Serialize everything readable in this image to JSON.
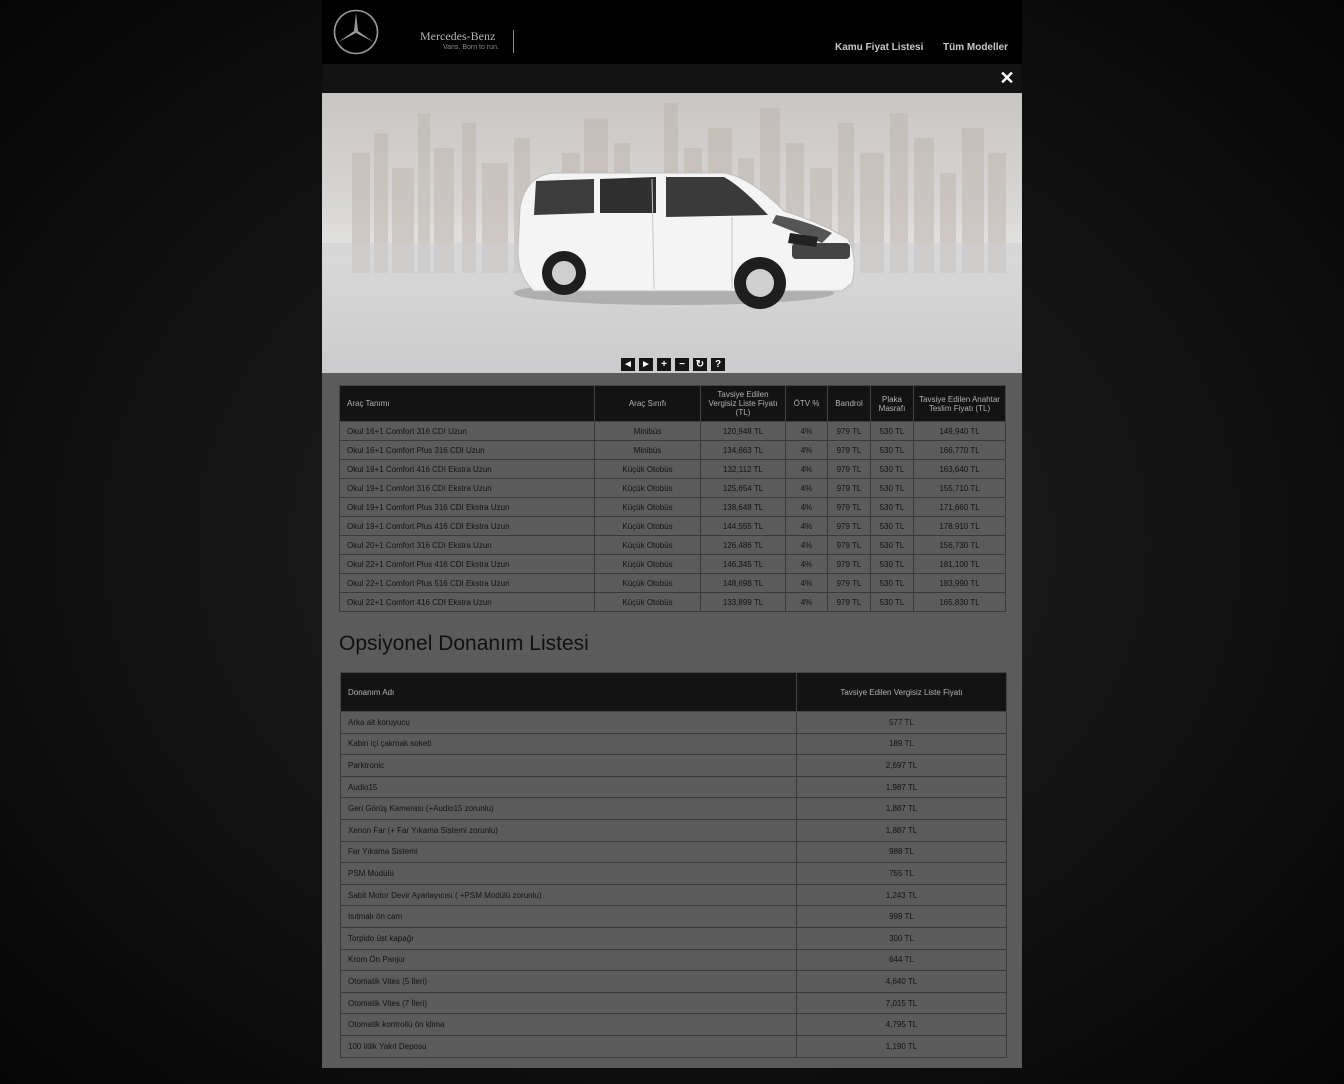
{
  "header": {
    "brand": "Mercedes-Benz",
    "tagline": "Vans. Born to run.",
    "nav": [
      {
        "label": "Kamu Fiyat Listesi"
      },
      {
        "label": "Tüm Modeller"
      }
    ]
  },
  "modal": {
    "close_glyph": "✕",
    "viewer_controls": [
      "◄",
      "►",
      "+",
      "−",
      "↻",
      "?"
    ]
  },
  "price_table": {
    "headers": {
      "name": "Araç Tanımı",
      "class": "Araç Sınıfı",
      "list_price": "Tavsiye Edilen Vergisiz Liste Fiyatı (TL)",
      "otv": "ÖTV %",
      "bandrol": "Bandrol",
      "plaka": "Plaka Masrafı",
      "key_price": "Tavsiye Edilen Anahtar Teslim Fiyatı (TL)"
    },
    "rows": [
      {
        "name": "Okul 16+1 Comfort 316 CDI Uzun",
        "class": "Minibüs",
        "list_price": "120,948 TL",
        "otv": "4%",
        "bandrol": "979 TL",
        "plaka": "530 TL",
        "key_price": "149,940 TL"
      },
      {
        "name": "Okul 16+1 Comfort Plus 316 CDI Uzun",
        "class": "Minibüs",
        "list_price": "134,663 TL",
        "otv": "4%",
        "bandrol": "979 TL",
        "plaka": "530 TL",
        "key_price": "166,770 TL"
      },
      {
        "name": "Okul 19+1 Comfort 416 CDI Ekstra Uzun",
        "class": "Küçük Otobüs",
        "list_price": "132,112 TL",
        "otv": "4%",
        "bandrol": "979 TL",
        "plaka": "530 TL",
        "key_price": "163,640 TL"
      },
      {
        "name": "Okul 19+1 Comfort 316 CDI Ekstra Uzun",
        "class": "Küçük Otobüs",
        "list_price": "125,654 TL",
        "otv": "4%",
        "bandrol": "979 TL",
        "plaka": "530 TL",
        "key_price": "155,710 TL"
      },
      {
        "name": "Okul 19+1 Comfort Plus 316 CDI Ekstra Uzun",
        "class": "Küçük Otobüs",
        "list_price": "138,648 TL",
        "otv": "4%",
        "bandrol": "979 TL",
        "plaka": "530 TL",
        "key_price": "171,660 TL"
      },
      {
        "name": "Okul 19+1 Comfort Plus 416 CDI Ekstra Uzun",
        "class": "Küçük Otobüs",
        "list_price": "144,555 TL",
        "otv": "4%",
        "bandrol": "979 TL",
        "plaka": "530 TL",
        "key_price": "178,910 TL"
      },
      {
        "name": "Okul 20+1 Comfort 316 CDI Ekstra Uzun",
        "class": "Küçük Otobüs",
        "list_price": "126,486 TL",
        "otv": "4%",
        "bandrol": "979 TL",
        "plaka": "530 TL",
        "key_price": "156,730 TL"
      },
      {
        "name": "Okul 22+1 Comfort Plus 416 CDI Ekstra Uzun",
        "class": "Küçük Otobüs",
        "list_price": "146,345 TL",
        "otv": "4%",
        "bandrol": "979 TL",
        "plaka": "530 TL",
        "key_price": "181,100 TL"
      },
      {
        "name": "Okul 22+1 Comfort Plus 516 CDI Ekstra Uzun",
        "class": "Küçük Otobüs",
        "list_price": "148,698 TL",
        "otv": "4%",
        "bandrol": "979 TL",
        "plaka": "530 TL",
        "key_price": "183,990 TL"
      },
      {
        "name": "Okul 22+1 Comfort 416 CDI Ekstra Uzun",
        "class": "Küçük Otobüs",
        "list_price": "133,899 TL",
        "otv": "4%",
        "bandrol": "979 TL",
        "plaka": "530 TL",
        "key_price": "165,830 TL"
      }
    ]
  },
  "options_section": {
    "title": "Opsiyonel Donanım Listesi",
    "headers": {
      "name": "Donanım Adı",
      "price": "Tavsiye Edilen Vergisiz Liste Fiyatı"
    },
    "rows": [
      {
        "name": "Arka alt koruyucu",
        "price": "577 TL"
      },
      {
        "name": "Kabin içi çakmak soketi",
        "price": "189 TL"
      },
      {
        "name": "Parktronic",
        "price": "2,697 TL"
      },
      {
        "name": "Audio15",
        "price": "1,987 TL"
      },
      {
        "name": "Geri Görüş Kamerası (+Audio15 zorunlu)",
        "price": "1,887 TL"
      },
      {
        "name": "Xenon Far (+ Far Yıkama Sistemi zorunlu)",
        "price": "1,887 TL"
      },
      {
        "name": "Far Yıkama Sistemi",
        "price": "988 TL"
      },
      {
        "name": "PSM Modülü",
        "price": "755 TL"
      },
      {
        "name": "Sabit Motor Devir Ayarlayıcısı ( +PSM Modülü zorunlu)",
        "price": "1,243 TL"
      },
      {
        "name": "Isıtmalı ön cam",
        "price": "999 TL"
      },
      {
        "name": "Torpido üst kapağı",
        "price": "300 TL"
      },
      {
        "name": "Krom Ön Panjur",
        "price": "644 TL"
      },
      {
        "name": "Otomatik Vites (5 İleri)",
        "price": "4,640 TL"
      },
      {
        "name": "Otomatik Vites (7 İleri)",
        "price": "7,015 TL"
      },
      {
        "name": "Otomatik kontrollü ön klima",
        "price": "4,795 TL"
      },
      {
        "name": "100 litlik Yakıt Deposu",
        "price": "1,190 TL"
      }
    ]
  }
}
